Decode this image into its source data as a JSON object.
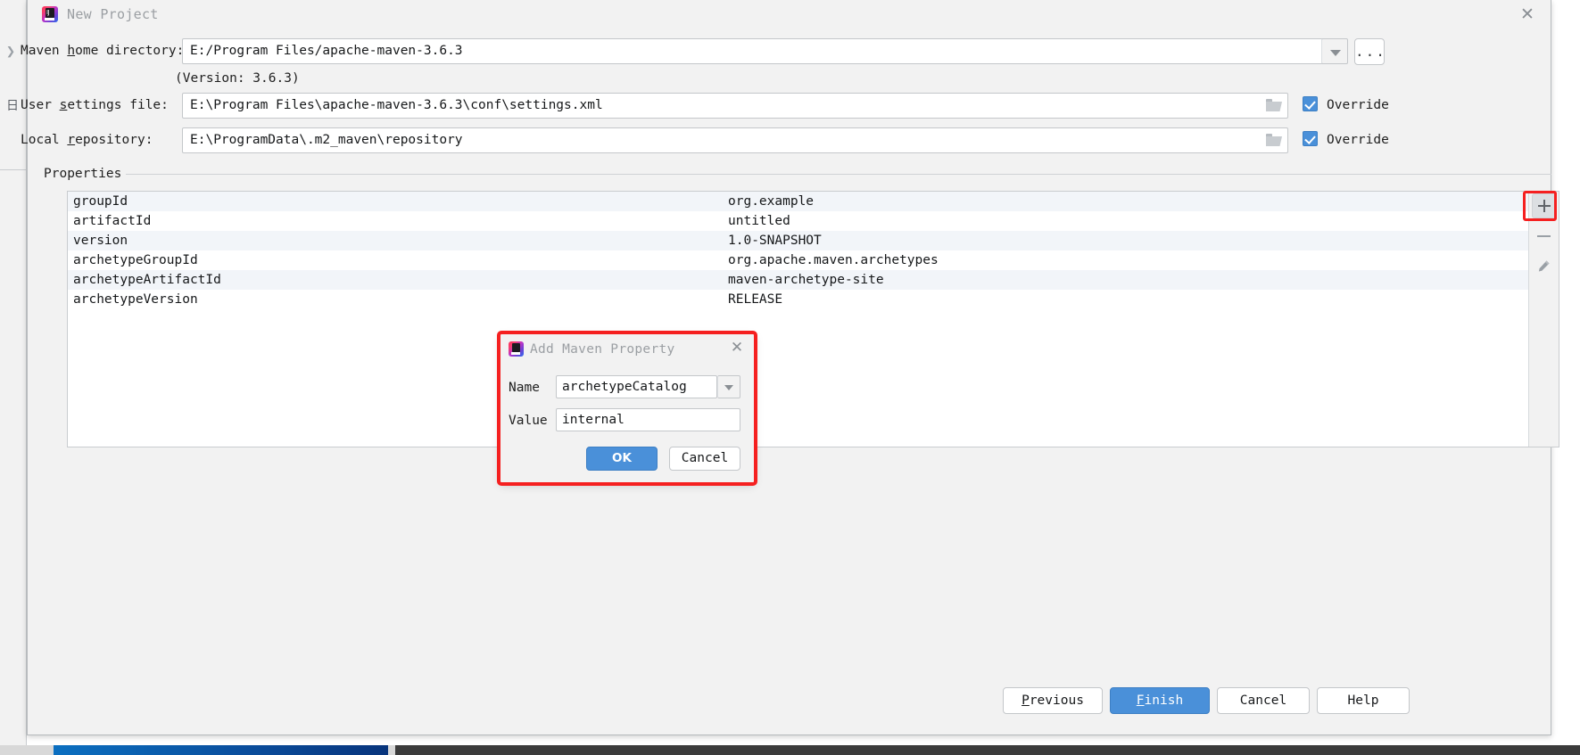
{
  "window": {
    "title": "New Project",
    "icon": "intellij-idea-icon",
    "close_label": "✕"
  },
  "form": {
    "maven_home": {
      "label_pre": "Maven ",
      "label_mnemonic": "h",
      "label_post": "ome directory:",
      "value": "E:/Program Files/apache-maven-3.6.3",
      "version_note": "(Version: 3.6.3)",
      "ellipsis_label": "..."
    },
    "user_settings": {
      "label_pre": "User ",
      "label_mnemonic": "s",
      "label_post": "ettings file:",
      "value": "E:\\Program Files\\apache-maven-3.6.3\\conf\\settings.xml",
      "override_label": "Override",
      "override_checked": true
    },
    "local_repository": {
      "label_pre": "Local ",
      "label_mnemonic": "r",
      "label_post": "epository:",
      "value": "E:\\ProgramData\\.m2_maven\\repository",
      "override_label": "Override",
      "override_checked": true
    }
  },
  "properties": {
    "section_label": "Properties",
    "rows": [
      {
        "key": "groupId",
        "value": "org.example"
      },
      {
        "key": "artifactId",
        "value": "untitled"
      },
      {
        "key": "version",
        "value": "1.0-SNAPSHOT"
      },
      {
        "key": "archetypeGroupId",
        "value": "org.apache.maven.archetypes"
      },
      {
        "key": "archetypeArtifactId",
        "value": "maven-archetype-site"
      },
      {
        "key": "archetypeVersion",
        "value": "RELEASE"
      }
    ],
    "toolbar": {
      "add_label": "+",
      "remove_label": "−",
      "edit_label": "edit"
    }
  },
  "modal": {
    "title": "Add Maven Property",
    "close_label": "✕",
    "name_label": "Name",
    "name_value": "archetypeCatalog",
    "value_label": "Value",
    "value_value": "internal",
    "ok_label": "OK",
    "cancel_label": "Cancel"
  },
  "footer": {
    "previous": {
      "pre": "",
      "mnemonic": "P",
      "post": "revious"
    },
    "finish": {
      "pre": "",
      "mnemonic": "F",
      "post": "inish"
    },
    "cancel": {
      "pre": "Cancel",
      "mnemonic": "",
      "post": ""
    },
    "help": {
      "pre": "Help",
      "mnemonic": "",
      "post": ""
    }
  },
  "colors": {
    "accent_blue": "#4a90d9",
    "highlight_red": "#f52020",
    "row_alt": "#f2f5f9",
    "window_bg": "#f2f2f2"
  }
}
